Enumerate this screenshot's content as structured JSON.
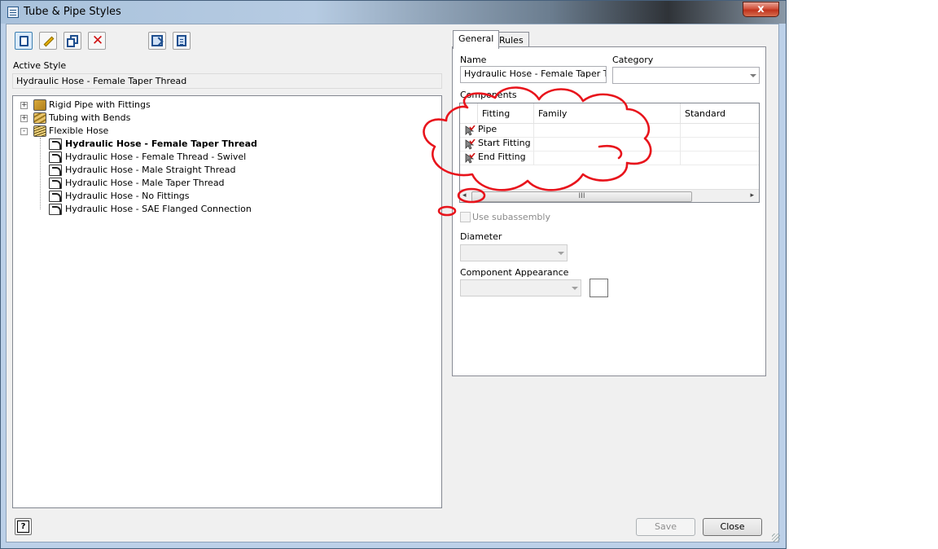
{
  "window": {
    "title": "Tube & Pipe Styles",
    "close_glyph": "x",
    "title_icon": "window-app-icon"
  },
  "toolbar": {
    "buttons": [
      {
        "name": "new-style-button",
        "icon": "new-document-icon"
      },
      {
        "name": "edit-style-button",
        "icon": "pencil-icon"
      },
      {
        "name": "copy-style-button",
        "icon": "copy-icon"
      },
      {
        "name": "delete-style-button",
        "icon": "delete-x-icon"
      },
      {
        "name": "export-button",
        "icon": "export-icon"
      },
      {
        "name": "import-button",
        "icon": "import-icon"
      }
    ]
  },
  "active_style": {
    "label": "Active Style",
    "value": "Hydraulic Hose - Female Taper Thread"
  },
  "tree": {
    "groups": [
      {
        "label": "Rigid Pipe with Fittings",
        "expander": "+",
        "icon": "rigid-pipe-icon"
      },
      {
        "label": "Tubing with Bends",
        "expander": "+",
        "icon": "tubing-icon"
      },
      {
        "label": "Flexible Hose",
        "expander": "-",
        "icon": "flexible-hose-icon"
      }
    ],
    "children": [
      {
        "label": "Hydraulic Hose - Female Taper Thread",
        "active": true
      },
      {
        "label": "Hydraulic Hose - Female Thread - Swivel"
      },
      {
        "label": "Hydraulic Hose - Male Straight Thread"
      },
      {
        "label": "Hydraulic Hose - Male Taper Thread"
      },
      {
        "label": "Hydraulic Hose - No Fittings"
      },
      {
        "label": "Hydraulic Hose - SAE Flanged Connection"
      }
    ]
  },
  "tabs": [
    {
      "label": "General",
      "active": true
    },
    {
      "label": "Rules"
    }
  ],
  "general": {
    "name_label": "Name",
    "name_value": "Hydraulic Hose - Female Taper Thread",
    "category_label": "Category",
    "category_value": "",
    "components_label": "Components",
    "columns": [
      "Fitting",
      "Family",
      "Standard"
    ],
    "rows": [
      {
        "fitting": "Pipe",
        "family": "",
        "standard": ""
      },
      {
        "fitting": "Start Fitting",
        "family": "",
        "standard": ""
      },
      {
        "fitting": "End Fitting",
        "family": "",
        "standard": ""
      }
    ],
    "scroll_left": "◂",
    "scroll_right": "▸",
    "scroll_thumb": "III",
    "use_subassembly_label": "Use subassembly",
    "diameter_label": "Diameter",
    "diameter_value": "",
    "appearance_label": "Component Appearance",
    "appearance_value": ""
  },
  "footer": {
    "help_label": "?",
    "save_label": "Save",
    "close_label": "Close"
  },
  "colors": {
    "annotation_red": "#e8141c",
    "selection_blue": "#3c7fb1"
  }
}
